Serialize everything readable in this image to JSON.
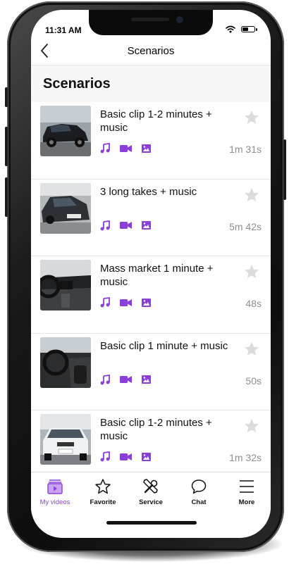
{
  "status_bar": {
    "time": "11:31 AM"
  },
  "nav": {
    "title": "Scenarios",
    "back_icon": "chevron-left-icon"
  },
  "section_title": "Scenarios",
  "accent_color": "#8b3fd9",
  "scenarios": [
    {
      "title": "Basic clip 1-2 minutes + music",
      "duration": "1m 31s",
      "favorite": false
    },
    {
      "title": "3 long takes + music",
      "duration": "5m 42s",
      "favorite": false
    },
    {
      "title": "Mass market 1 minute + music",
      "duration": "48s",
      "favorite": false
    },
    {
      "title": "Basic clip 1 minute + music",
      "duration": "50s",
      "favorite": false
    },
    {
      "title": "Basic clip 1-2 minutes + music",
      "duration": "1m 32s",
      "favorite": false
    }
  ],
  "media_icons": [
    "music-note-icon",
    "video-camera-icon",
    "image-icon"
  ],
  "tabs": [
    {
      "label": "My videos",
      "icon": "video-folder-icon",
      "active": true
    },
    {
      "label": "Favorite",
      "icon": "star-icon",
      "active": false
    },
    {
      "label": "Service",
      "icon": "tools-icon",
      "active": false
    },
    {
      "label": "Chat",
      "icon": "chat-bubble-icon",
      "active": false
    },
    {
      "label": "More",
      "icon": "hamburger-menu-icon",
      "active": false
    }
  ]
}
